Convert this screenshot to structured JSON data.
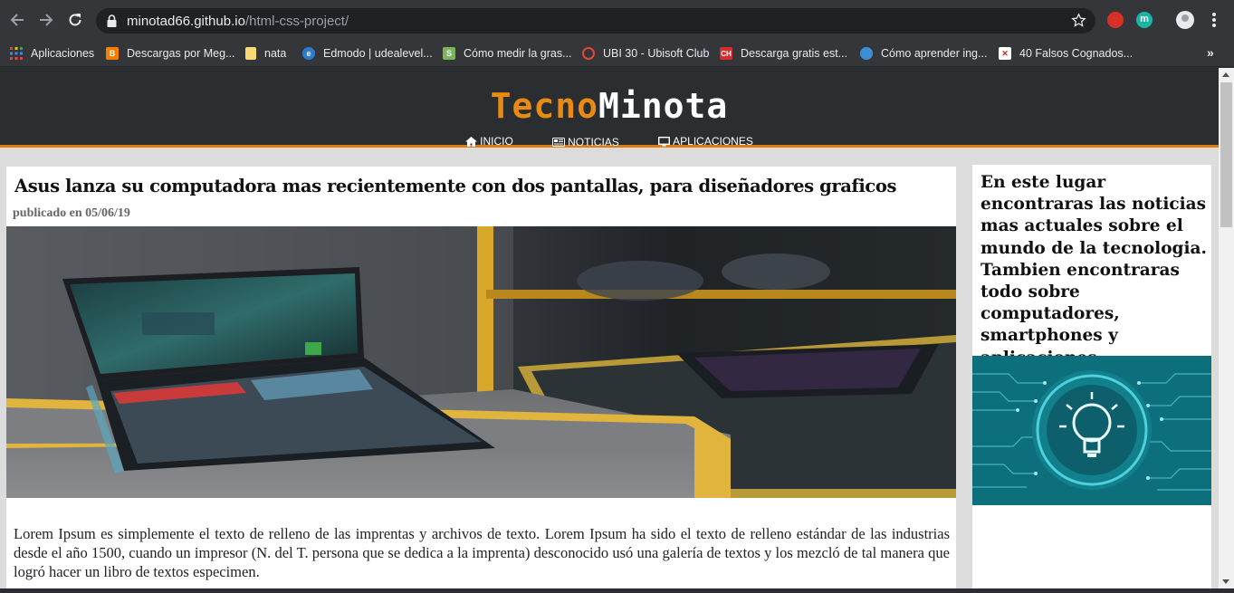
{
  "browser": {
    "url_host": "minotad66.github.io",
    "url_path": "/html-css-project/",
    "bookmarks": [
      {
        "label": "Aplicaciones",
        "icon": "apps-grid-icon",
        "color": "#e8eaed"
      },
      {
        "label": "Descargas por Meg...",
        "icon": "blogger-icon",
        "color": "#f57d00"
      },
      {
        "label": "nata",
        "icon": "folder-icon",
        "color": "#f8d775"
      },
      {
        "label": "Edmodo | udealevel...",
        "icon": "edmodo-icon",
        "color": "#2e7bcf"
      },
      {
        "label": "Cómo medir la gras...",
        "icon": "shopify-icon",
        "color": "#7ab55c"
      },
      {
        "label": "UBI 30 - Ubisoft Club",
        "icon": "ubisoft-icon",
        "color": "#e4473b"
      },
      {
        "label": "Descarga gratis est...",
        "icon": "ch-icon",
        "color": "#d32f2f"
      },
      {
        "label": "Cómo aprender ing...",
        "icon": "globe-icon",
        "color": "#3a8fd6"
      },
      {
        "label": "40 Falsos Cognados...",
        "icon": "flag-icon",
        "color": "#ffffff"
      }
    ]
  },
  "site": {
    "logo_part1": "Tecno",
    "logo_part2": "Minota",
    "accent_color": "#e07b12",
    "nav": [
      {
        "label": "INICIO",
        "icon": "home-icon"
      },
      {
        "label": "NOTICIAS",
        "icon": "newspaper-icon"
      },
      {
        "label": "APLICACIONES",
        "icon": "desktop-icon"
      }
    ]
  },
  "article": {
    "title": "Asus lanza su computadora mas recientemente con dos pantallas, para diseñadores graficos",
    "date": "publicado en 05/06/19",
    "image_subject": "dual-screen laptop on display stand",
    "body": "Lorem Ipsum es simplemente el texto de relleno de las imprentas y archivos de texto. Lorem Ipsum ha sido el texto de relleno estándar de las industrias desde el año 1500, cuando un impresor (N. del T. persona que se dedica a la imprenta) desconocido usó una galería de textos y los mezcló de tal manera que logró hacer un libro de textos especimen."
  },
  "sidebar": {
    "text": "En este lugar encontraras las noticias mas actuales sobre el mundo de la tecnologia. Tambien encontraras todo sobre computadores, smartphones y aplicaciones.",
    "image_subject": "light bulb with circuit lines"
  }
}
